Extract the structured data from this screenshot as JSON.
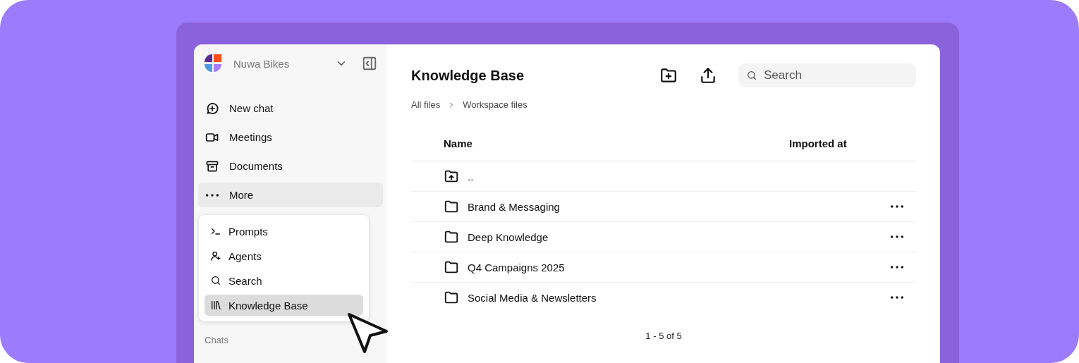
{
  "workspace": {
    "name": "Nuwa Bikes"
  },
  "nav": [
    {
      "label": "New chat",
      "selected": false
    },
    {
      "label": "Meetings",
      "selected": false
    },
    {
      "label": "Documents",
      "selected": false
    },
    {
      "label": "More",
      "selected": true
    }
  ],
  "more_menu": [
    {
      "label": "Prompts",
      "selected": false
    },
    {
      "label": "Agents",
      "selected": false
    },
    {
      "label": "Search",
      "selected": false
    },
    {
      "label": "Knowledge Base",
      "selected": true
    }
  ],
  "sidebar_section": "Chats",
  "page": {
    "title": "Knowledge Base",
    "search": {
      "placeholder": "Search"
    }
  },
  "breadcrumbs": [
    "All files",
    "Workspace files"
  ],
  "table": {
    "columns": [
      "Name",
      "Imported at"
    ],
    "rows": [
      {
        "kind": "parent",
        "name": ".."
      },
      {
        "kind": "folder",
        "name": "Brand & Messaging"
      },
      {
        "kind": "folder",
        "name": "Deep Knowledge"
      },
      {
        "kind": "folder",
        "name": "Q4 Campaigns 2025"
      },
      {
        "kind": "folder",
        "name": "Social Media & Newsletters"
      }
    ]
  },
  "pagination": "1 - 5 of 5"
}
